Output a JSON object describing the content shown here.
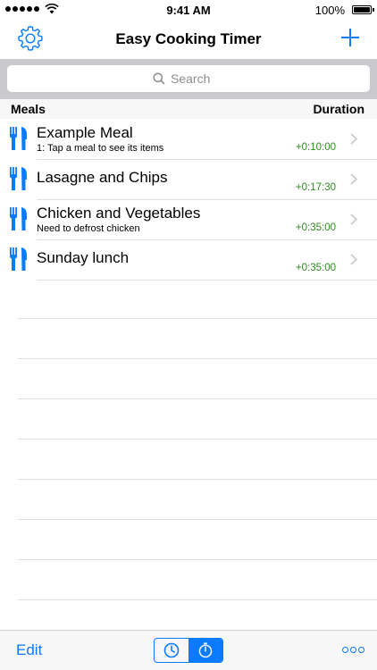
{
  "status_bar": {
    "time": "9:41 AM",
    "battery": "100%"
  },
  "nav": {
    "title": "Easy Cooking Timer",
    "left_icon": "gear-icon",
    "right_icon": "plus-icon"
  },
  "search": {
    "placeholder": "Search"
  },
  "section_header": {
    "left": "Meals",
    "right": "Duration"
  },
  "meals": [
    {
      "title": "Example Meal",
      "subtitle": "1: Tap a meal to see its items",
      "duration": "+0:10:00",
      "icon": "fork-knife-icon"
    },
    {
      "title": "Lasagne and Chips",
      "subtitle": "",
      "duration": "+0:17:30",
      "icon": "fork-knife-icon"
    },
    {
      "title": "Chicken and Vegetables",
      "subtitle": "Need to defrost chicken",
      "duration": "+0:35:00",
      "icon": "fork-knife-icon"
    },
    {
      "title": "Sunday lunch",
      "subtitle": "",
      "duration": "+0:35:00",
      "icon": "fork-knife-icon"
    }
  ],
  "toolbar": {
    "edit_label": "Edit",
    "segment_items": [
      "clock-icon",
      "stopwatch-icon"
    ],
    "selected_segment": 1,
    "more_icon": "more-icon"
  },
  "colors": {
    "accent": "#0a7aff",
    "duration": "#2e8b20",
    "search_bar_bg": "#c9c9ce",
    "header_bg": "#f7f7f7"
  }
}
